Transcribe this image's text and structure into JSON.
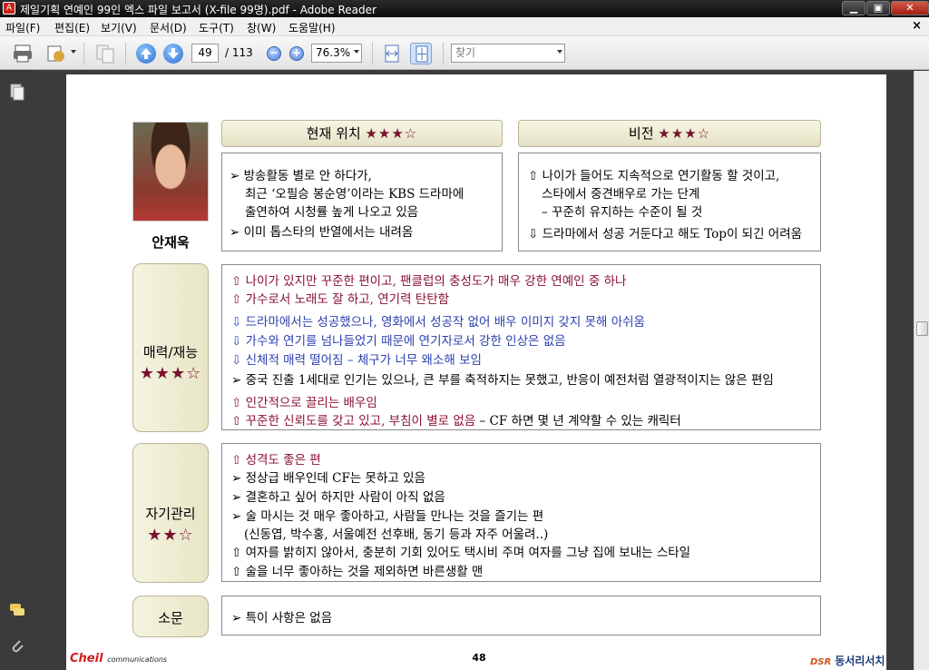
{
  "window": {
    "title": "제일기획 연예인 99인 엑스 파일 보고서 (X-file 99명).pdf - Adobe Reader",
    "app_icon_glyph": "A",
    "minimize": "▁",
    "maximize": "▣",
    "close": "✕"
  },
  "menu": {
    "items": [
      "파일(F)",
      "편집(E)",
      "보기(V)",
      "문서(D)",
      "도구(T)",
      "창(W)",
      "도움말(H)"
    ],
    "doc_close": "×"
  },
  "toolbar": {
    "page_current": "49",
    "page_total": "/ 113",
    "zoom_out": "−",
    "zoom_in": "+",
    "zoom_value": "76.3%",
    "search_placeholder": "찾기",
    "icons": [
      "print-icon",
      "email-icon",
      "pages-icon",
      "previous-page-icon",
      "next-page-icon",
      "zoom-out-icon",
      "zoom-in-icon",
      "fit-width-icon",
      "fit-page-icon"
    ]
  },
  "page": {
    "person_name": "안재욱",
    "sections": {
      "current_position": {
        "label": "현재 위치",
        "stars": "★★★☆"
      },
      "vision": {
        "label": "비전",
        "stars": "★★★☆"
      },
      "charm": {
        "label": "매력/재능",
        "stars": "★★★☆"
      },
      "self_management": {
        "label": "자기관리",
        "stars": "★★☆"
      },
      "rumor": {
        "label": "소문"
      }
    },
    "current_position_lines": [
      "➢ 방송활동 별로 안 하다가,",
      "최근 ‘오필승 봉순영’이라는 KBS 드라마에",
      "출연하여 시청률 높게 나오고 있음",
      "➢ 이미 톱스타의 반열에서는 내려옴"
    ],
    "vision_lines": [
      "⇧ 나이가 들어도 지속적으로 연기활동 할 것이고,",
      "스타에서 중견배우로 가는 단계",
      "– 꾸준히 유지하는 수준이 될 것",
      "⇩ 드라마에서 성공 거둔다고 해도 Top이 되긴 어려움"
    ],
    "charm_lines": [
      "⇧ 나이가 있지만 꾸준한 편이고, 팬클럽의 충성도가 매우 강한 연예인 중 하나",
      "⇧ 가수로서 노래도 잘 하고, 연기력 탄탄함",
      "⇩ 드라마에서는 성공했으나, 영화에서 성공작 없어 배우 이미지 갖지 못해 아쉬움",
      "⇩ 가수와 연기를 넘나들었기 때문에 연기자로서 강한 인상은 없음",
      "⇩ 신체적 매력 떨어짐 – 체구가 너무 왜소해 보임",
      "➢ 중국 진출 1세대로 인기는 있으나, 큰 부를 축적하지는 못했고,  반응이 예전처럼 열광적이지는 않은 편임",
      "⇧ 인간적으로 끌리는 배우임",
      "⇧ 꾸준한 신뢰도를 갖고 있고, 부침이 별로 없음",
      " – CF 하면 몇 년 계약할 수 있는 캐릭터"
    ],
    "self_management_lines": [
      "⇧ 성격도 좋은 편",
      "➢ 정상급 배우인데 CF는 못하고 있음",
      "➢ 결혼하고 싶어 하지만 사람이 아직 없음",
      "➢ 술 마시는 것 매우 좋아하고, 사람들 만나는 것을 즐기는 편",
      "(신동엽, 박수홍, 서울예전 선후배, 동기 등과 자주 어울려..)",
      "⇧ 여자를 밝히지 않아서, 충분히 기회 있어도 택시비 주며 여자를 그냥 집에 보내는 스타일",
      "⇧ 술을 너무 좋아하는 것을 제외하면 바른생활 맨"
    ],
    "rumor_lines": [
      "➢ 특이 사항은 없음"
    ],
    "footer": {
      "logo": "Cheil",
      "logo_sub": "communications",
      "page_number": "48",
      "company_mark": "DSR",
      "company": "동서리서치"
    }
  },
  "colors": {
    "header_bg": "#e9e7cb",
    "star_red": "#7a1030",
    "positive_text": "#8a1030",
    "negative_text": "#2b3fb0"
  }
}
